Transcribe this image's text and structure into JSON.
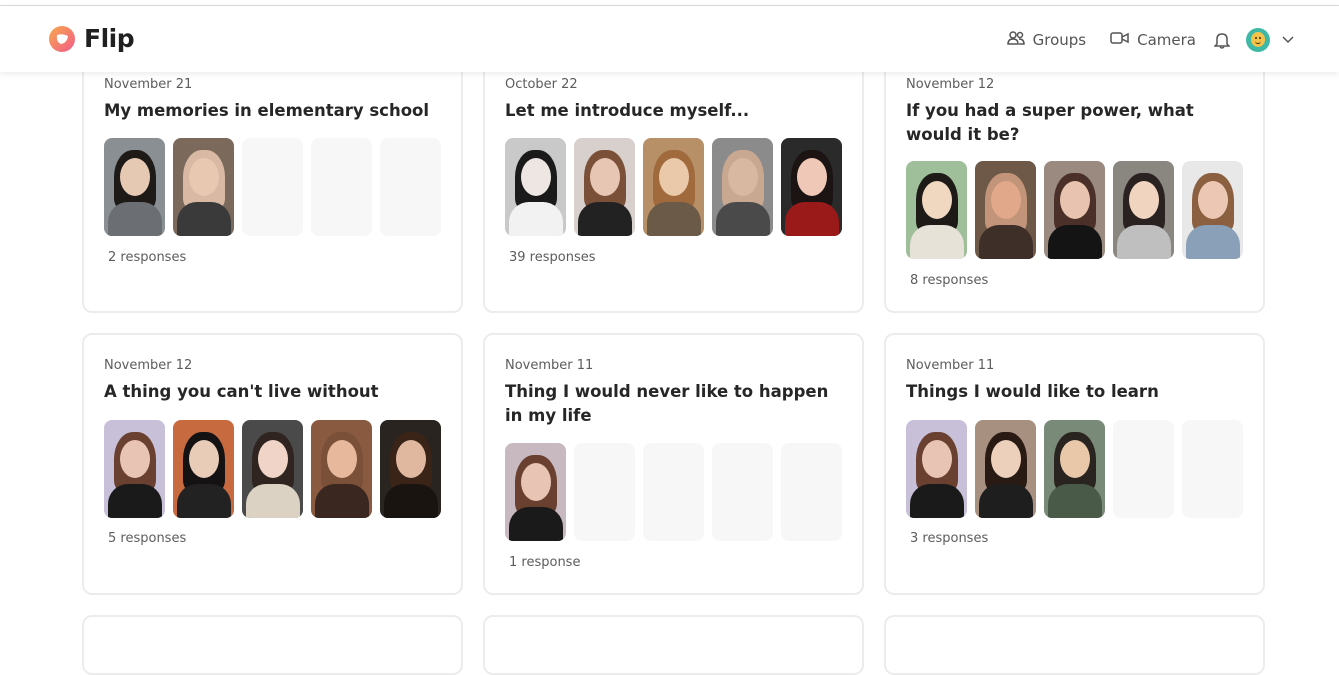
{
  "app": {
    "name": "Flip"
  },
  "nav": {
    "groups": "Groups",
    "camera": "Camera"
  },
  "colors": {
    "brand_pink": "#f25c8a",
    "brand_orange": "#f7a84a",
    "card_border": "#ececec"
  },
  "icons": [
    "flip-logo-icon",
    "groups-icon",
    "camera-icon",
    "bell-icon",
    "user-avatar",
    "chevron-down-icon"
  ],
  "cards": [
    {
      "date": "November 21",
      "title": "My memories in elementary school",
      "count": "2 responses",
      "thumbs": [
        {
          "bg": "#8a8f94",
          "hair": "#1e1a18",
          "skin": "#e6c9b3",
          "body": "#6b6f73"
        },
        {
          "bg": "#7b6a5c",
          "hair": "#d9b9a4",
          "skin": "#e8c8b0",
          "body": "#3a3a3a"
        },
        null,
        null,
        null
      ]
    },
    {
      "date": "October 22",
      "title": "Let me introduce myself...",
      "count": "39 responses",
      "thumbs": [
        {
          "bg": "#c9c9c9",
          "hair": "#1a1a1a",
          "skin": "#eee6e2",
          "body": "#f2f2f2"
        },
        {
          "bg": "#d8d0cc",
          "hair": "#7a5038",
          "skin": "#e8c6b4",
          "body": "#222222"
        },
        {
          "bg": "#b89068",
          "hair": "#a06a3c",
          "skin": "#eac8aa",
          "body": "#6b5a48"
        },
        {
          "bg": "#8b8b8b",
          "hair": "#c8a890",
          "skin": "#d8b8a0",
          "body": "#4a4a4a"
        },
        {
          "bg": "#2a2a2a",
          "hair": "#1b1413",
          "skin": "#f0c8b8",
          "body": "#9a1a1a"
        }
      ]
    },
    {
      "date": "November 12",
      "title": "If you had a super power, what would it be?",
      "count": "8 responses",
      "thumbs": [
        {
          "bg": "#9fbf9a",
          "hair": "#1e1a18",
          "skin": "#f0d8c0",
          "body": "#e6e2d8"
        },
        {
          "bg": "#6e5848",
          "hair": "#c2957a",
          "skin": "#e2a88a",
          "body": "#3e3028"
        },
        {
          "bg": "#9a8a80",
          "hair": "#4a3028",
          "skin": "#e8c4b0",
          "body": "#141414"
        },
        {
          "bg": "#8a8680",
          "hair": "#2a2220",
          "skin": "#f0d4c0",
          "body": "#bfbfbf"
        },
        {
          "bg": "#e8e8e8",
          "hair": "#8a6040",
          "skin": "#ecc8b4",
          "body": "#8aa0b8"
        }
      ]
    },
    {
      "date": "November 12",
      "title": "A thing you can't live without",
      "count": "5 responses",
      "thumbs": [
        {
          "bg": "#c8c0d8",
          "hair": "#6a4030",
          "skin": "#e8c4b4",
          "body": "#1a1a1a"
        },
        {
          "bg": "#c86a40",
          "hair": "#141212",
          "skin": "#e8ccb8",
          "body": "#222222"
        },
        {
          "bg": "#4a4a4a",
          "hair": "#302420",
          "skin": "#f0d4c8",
          "body": "#dcd2c4"
        },
        {
          "bg": "#8a5a40",
          "hair": "#7a5038",
          "skin": "#e8b89c",
          "body": "#3a2820"
        },
        {
          "bg": "#2a2420",
          "hair": "#3a2418",
          "skin": "#e0b8a0",
          "body": "#1a1410"
        }
      ]
    },
    {
      "date": "November 11",
      "title": "Thing I would never like to happen in my life",
      "count": "1 response",
      "thumbs": [
        {
          "bg": "#c8b8c0",
          "hair": "#6a4030",
          "skin": "#e8c4b4",
          "body": "#1a1a1a"
        },
        null,
        null,
        null,
        null
      ]
    },
    {
      "date": "November 11",
      "title": "Things I would like to learn",
      "count": "3 responses",
      "thumbs": [
        {
          "bg": "#c8c0d8",
          "hair": "#6a4030",
          "skin": "#e8c4b4",
          "body": "#1a1a1a"
        },
        {
          "bg": "#a89080",
          "hair": "#2a1a14",
          "skin": "#ecd0bc",
          "body": "#1e1e1e"
        },
        {
          "bg": "#7a8a78",
          "hair": "#2a2420",
          "skin": "#e8c8a8",
          "body": "#4a5a48"
        },
        null,
        null
      ]
    }
  ]
}
